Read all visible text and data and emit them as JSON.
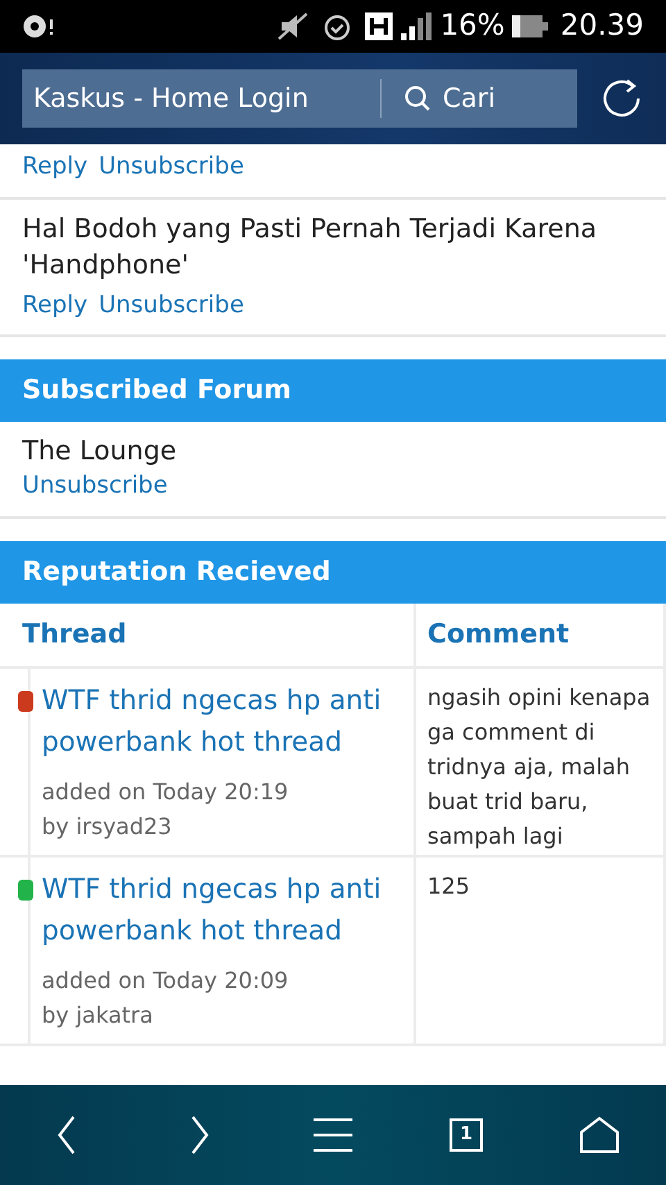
{
  "status_bar": {
    "battery": "16%",
    "time": "20.39"
  },
  "address_bar": {
    "title": "Kaskus - Home Login",
    "search_label": "Cari"
  },
  "subscribed_threads": [
    {
      "actions": [
        "Reply",
        "Unsubscribe"
      ]
    },
    {
      "title": "Hal Bodoh yang Pasti Pernah Terjadi Karena 'Handphone'",
      "actions": [
        "Reply",
        "Unsubscribe"
      ]
    }
  ],
  "subscribed_forum": {
    "heading": "Subscribed Forum",
    "items": [
      {
        "name": "The Lounge",
        "action": "Unsubscribe"
      }
    ]
  },
  "reputation": {
    "heading": "Reputation Recieved",
    "columns": [
      "Thread",
      "Comment"
    ],
    "rows": [
      {
        "color": "#cc3a1e",
        "thread": "WTF thrid ngecas hp anti powerbank hot thread",
        "added": "added on Today 20:19",
        "by": "by irsyad23",
        "comment": "ngasih opini kenapa ga comment di tridnya aja, malah buat trid baru, sampah lagi"
      },
      {
        "color": "#22b34a",
        "thread": "WTF thrid ngecas hp anti powerbank hot thread",
        "added": "added on Today 20:09",
        "by": "by jakatra",
        "comment": "125"
      }
    ]
  },
  "tab_count": "1"
}
